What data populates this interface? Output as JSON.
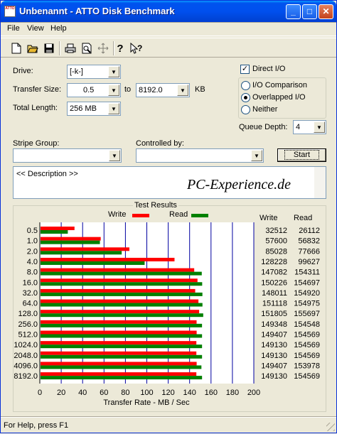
{
  "window": {
    "title": "Unbenannt - ATTO Disk Benchmark",
    "icon_text": "ATTO",
    "buttons": [
      "minimize",
      "maximize",
      "close"
    ]
  },
  "menu": [
    "File",
    "View",
    "Help"
  ],
  "toolbar": [
    "new-icon",
    "open-icon",
    "save-icon",
    "print-icon",
    "print-preview-icon",
    "move-icon",
    "help-icon",
    "context-help-icon"
  ],
  "form": {
    "drive_label": "Drive:",
    "drive_value": "[-k-]",
    "transfer_size_label": "Transfer Size:",
    "transfer_from": "0.5",
    "to_label": "to",
    "transfer_to": "8192.0",
    "unit": "KB",
    "total_length_label": "Total Length:",
    "total_length": "256 MB",
    "direct_io_label": "Direct I/O",
    "direct_io_checked": true,
    "options": [
      {
        "label": "I/O Comparison",
        "selected": false
      },
      {
        "label": "Overlapped I/O",
        "selected": true
      },
      {
        "label": "Neither",
        "selected": false
      }
    ],
    "queue_depth_label": "Queue Depth:",
    "queue_depth": "4",
    "stripe_group_label": "Stripe Group:",
    "stripe_group": "",
    "controlled_by_label": "Controlled by:",
    "controlled_by": "",
    "start_label": "Start"
  },
  "description": {
    "text": "<< Description >>",
    "watermark": "PC-Experience.de"
  },
  "results": {
    "title": "Test Results",
    "legend_write": "Write",
    "legend_read": "Read",
    "col_write": "Write",
    "col_read": "Read"
  },
  "chart_data": {
    "type": "bar",
    "orientation": "horizontal",
    "categories": [
      "0.5",
      "1.0",
      "2.0",
      "4.0",
      "8.0",
      "16.0",
      "32.0",
      "64.0",
      "128.0",
      "256.0",
      "512.0",
      "1024.0",
      "2048.0",
      "4096.0",
      "8192.0"
    ],
    "series": [
      {
        "name": "Write",
        "color": "#ff0000",
        "values": [
          32512,
          57600,
          85028,
          128228,
          147082,
          150226,
          148011,
          151118,
          151805,
          149348,
          149407,
          149130,
          149130,
          149407,
          149130
        ]
      },
      {
        "name": "Read",
        "color": "#008000",
        "values": [
          26112,
          56832,
          77666,
          99627,
          154311,
          154697,
          154920,
          154975,
          155697,
          154548,
          154569,
          154569,
          154569,
          153978,
          154569
        ]
      }
    ],
    "xlabel": "Transfer Rate - MB / Sec",
    "xticks": [
      0,
      20,
      40,
      60,
      80,
      100,
      120,
      140,
      160,
      180,
      200
    ],
    "xlim": [
      0,
      200
    ],
    "value_unit": "KB/s",
    "grid": "vertical",
    "grid_color": "#0000a0"
  },
  "status": "For Help, press F1"
}
